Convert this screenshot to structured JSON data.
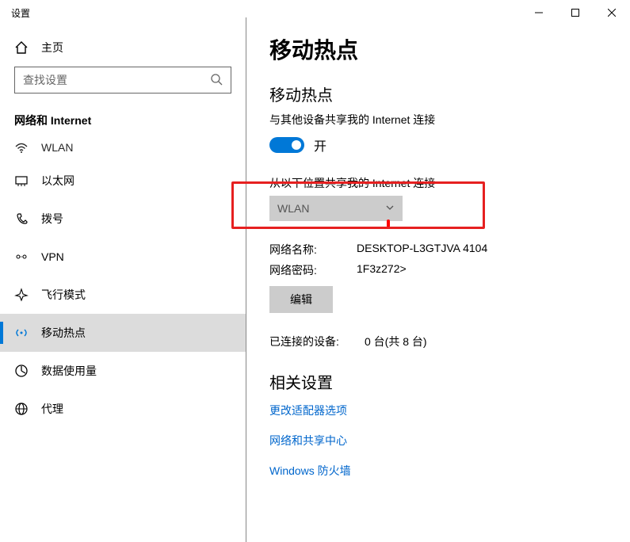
{
  "window": {
    "title": "设置"
  },
  "sidebar": {
    "home": "主页",
    "search_placeholder": "查找设置",
    "section": "网络和 Internet",
    "items": [
      {
        "icon": "wifi",
        "label": "WLAN"
      },
      {
        "icon": "ethernet",
        "label": "以太网"
      },
      {
        "icon": "dialup",
        "label": "拨号"
      },
      {
        "icon": "vpn",
        "label": "VPN"
      },
      {
        "icon": "airplane",
        "label": "飞行模式"
      },
      {
        "icon": "hotspot",
        "label": "移动热点"
      },
      {
        "icon": "data",
        "label": "数据使用量"
      },
      {
        "icon": "proxy",
        "label": "代理"
      }
    ]
  },
  "main": {
    "title": "移动热点",
    "section_title": "移动热点",
    "share_desc": "与其他设备共享我的 Internet 连接",
    "toggle_label": "开",
    "share_from_label": "从以下位置共享我的 Internet 连接",
    "dropdown_value": "WLAN",
    "net_name_key": "网络名称:",
    "net_name_val": "DESKTOP-L3GTJVA 4104",
    "net_pw_key": "网络密码:",
    "net_pw_val": "1F3z272>",
    "edit_btn": "编辑",
    "connected_key": "已连接的设备:",
    "connected_val": "0 台(共 8 台)",
    "related_title": "相关设置",
    "links": [
      "更改适配器选项",
      "网络和共享中心",
      "Windows 防火墙"
    ]
  }
}
